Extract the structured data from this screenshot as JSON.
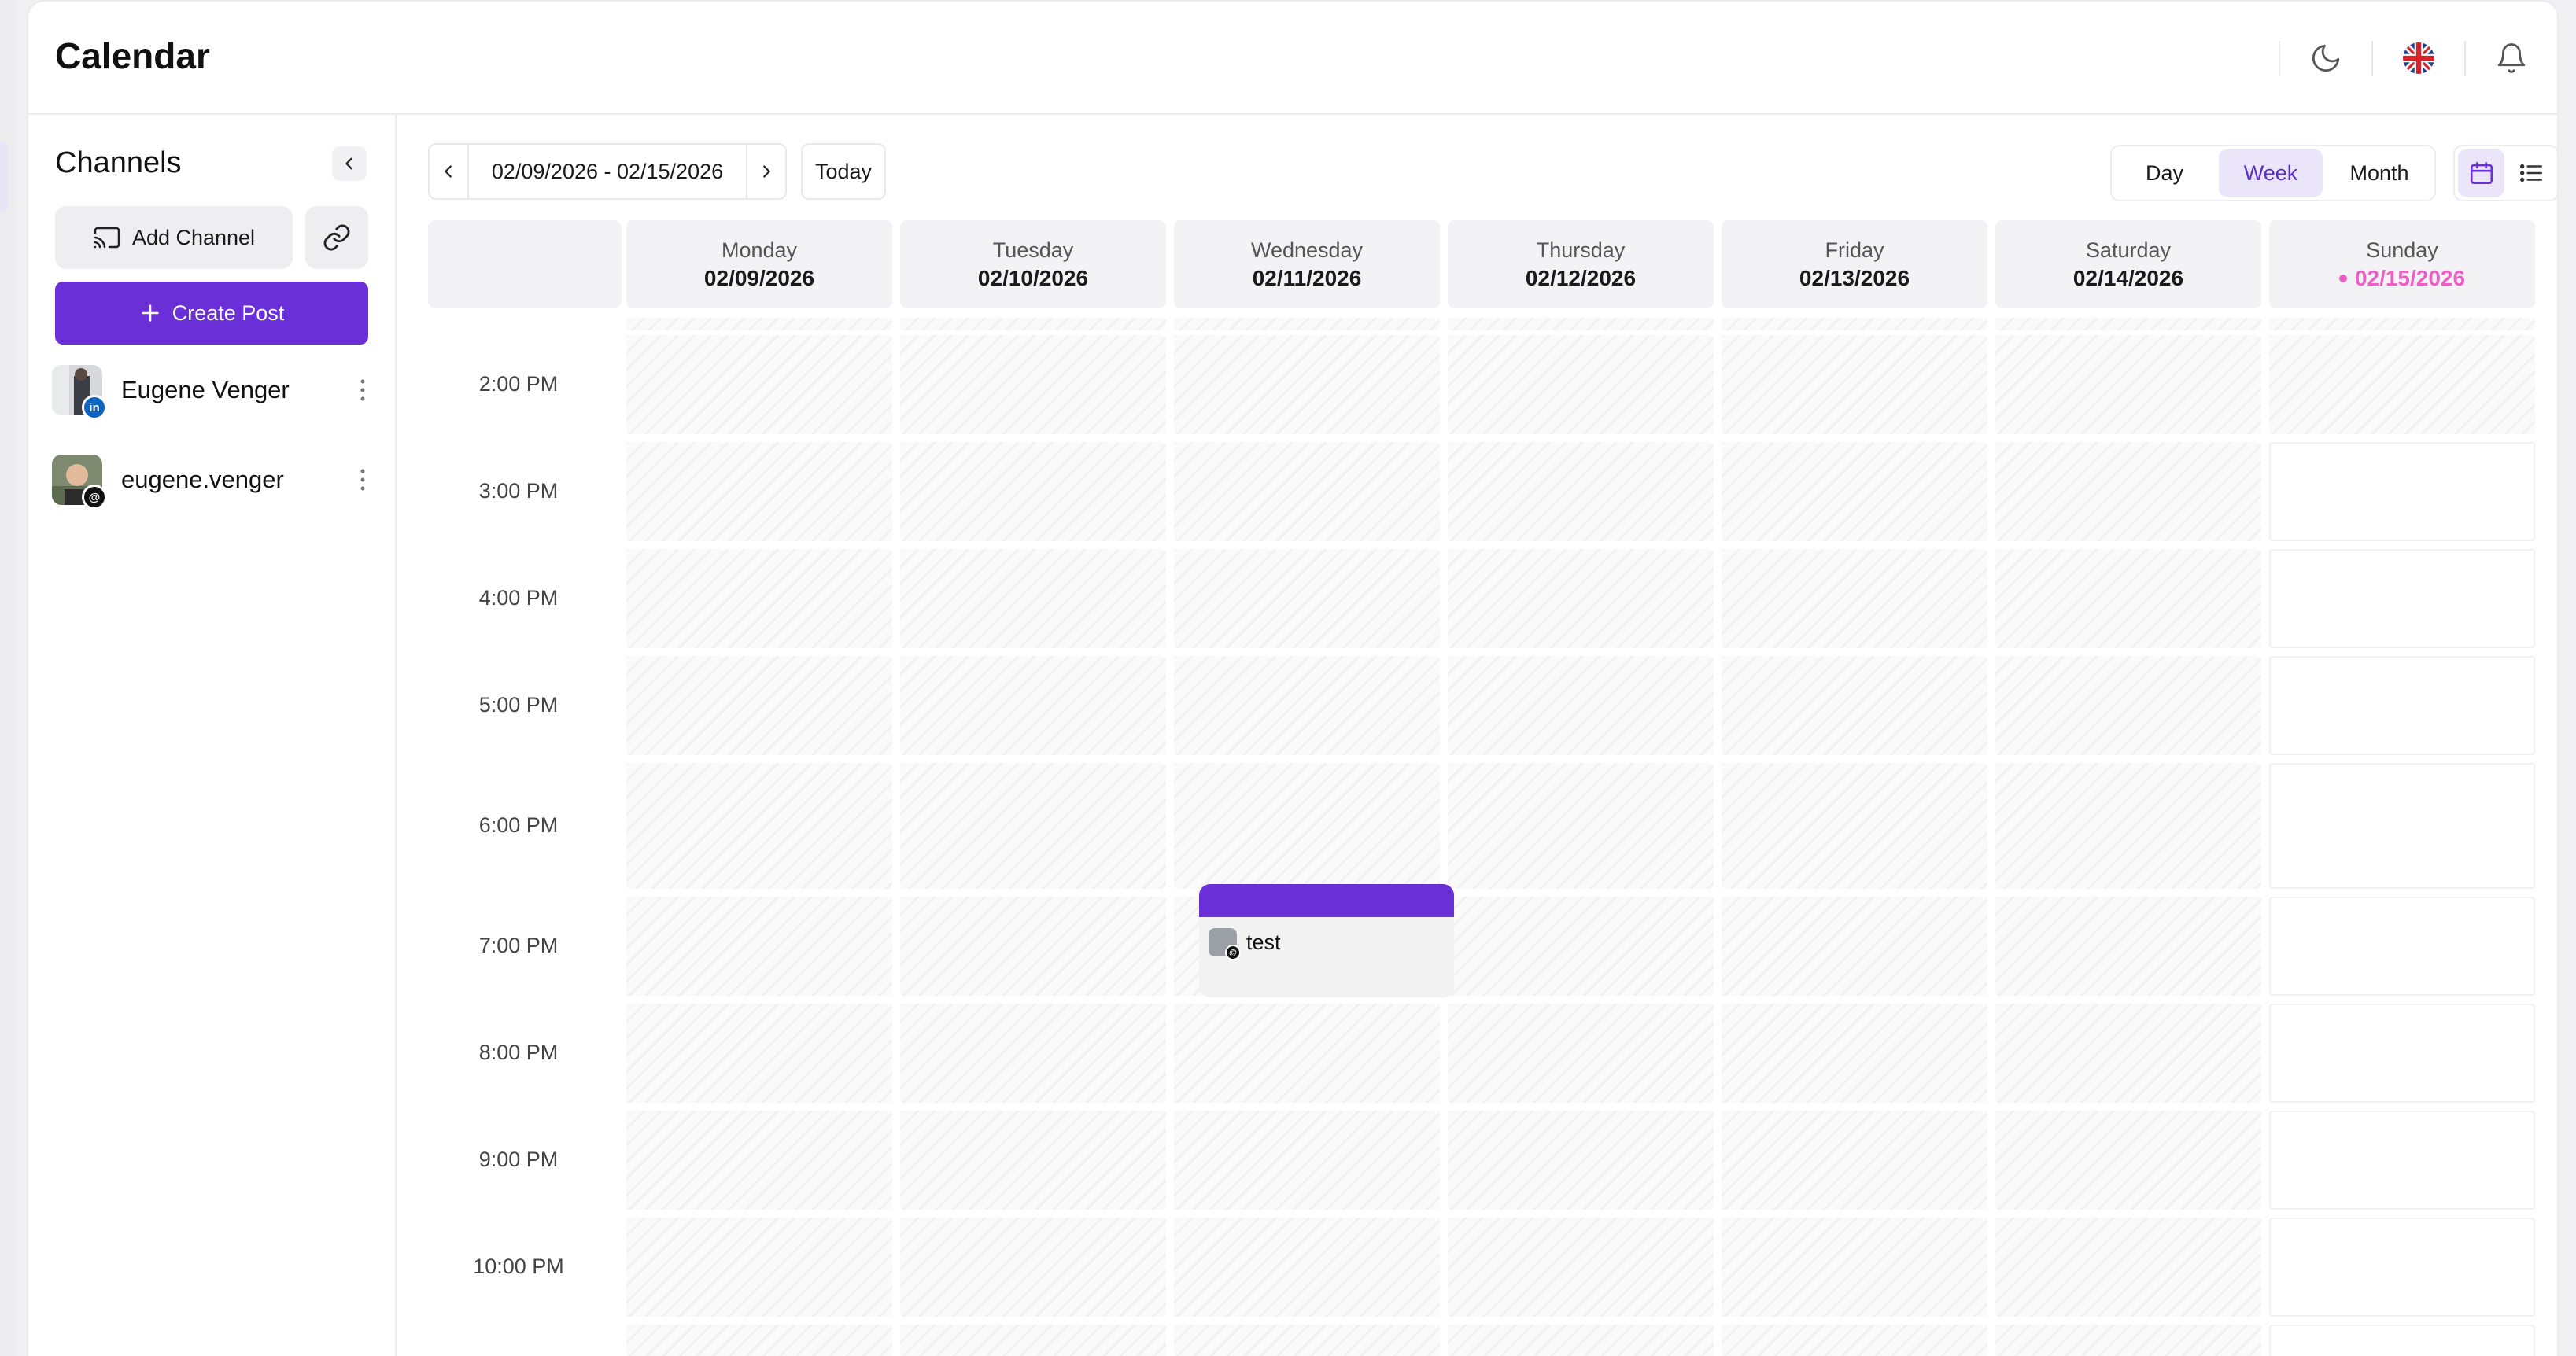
{
  "header": {
    "title": "Calendar"
  },
  "sidebar": {
    "title": "Channels",
    "add_channel_label": "Add Channel",
    "create_post_label": "Create Post",
    "channels": [
      {
        "name": "Eugene Venger",
        "network": "linkedin",
        "badge": "in"
      },
      {
        "name": "eugene.venger",
        "network": "threads",
        "badge": "@"
      }
    ]
  },
  "toolbar": {
    "date_range": "02/09/2026 - 02/15/2026",
    "today_label": "Today",
    "views": [
      "Day",
      "Week",
      "Month"
    ],
    "active_view": "Week"
  },
  "week": {
    "days": [
      {
        "name": "Monday",
        "date": "02/09/2026",
        "today": false
      },
      {
        "name": "Tuesday",
        "date": "02/10/2026",
        "today": false
      },
      {
        "name": "Wednesday",
        "date": "02/11/2026",
        "today": false
      },
      {
        "name": "Thursday",
        "date": "02/12/2026",
        "today": false
      },
      {
        "name": "Friday",
        "date": "02/13/2026",
        "today": false
      },
      {
        "name": "Saturday",
        "date": "02/14/2026",
        "today": false
      },
      {
        "name": "Sunday",
        "date": "02/15/2026",
        "today": true
      }
    ],
    "times": [
      "2:00 PM",
      "3:00 PM",
      "4:00 PM",
      "5:00 PM",
      "6:00 PM",
      "7:00 PM",
      "8:00 PM",
      "9:00 PM",
      "10:00 PM"
    ]
  },
  "event": {
    "title": "test",
    "day": "Wednesday",
    "time": "6:00 PM",
    "channel_network": "threads"
  },
  "colors": {
    "accent": "#6a2fd6",
    "today": "#ee5fc6",
    "active_view_bg": "#ebe5f9"
  },
  "icons": {
    "theme": "moon-icon",
    "language": "uk-flag-icon",
    "notifications": "bell-icon",
    "collapse": "chevron-left-icon",
    "add_channel": "cast-icon",
    "link": "link-icon",
    "create": "plus-icon",
    "calendar_view": "calendar-icon",
    "list_view": "list-icon"
  }
}
